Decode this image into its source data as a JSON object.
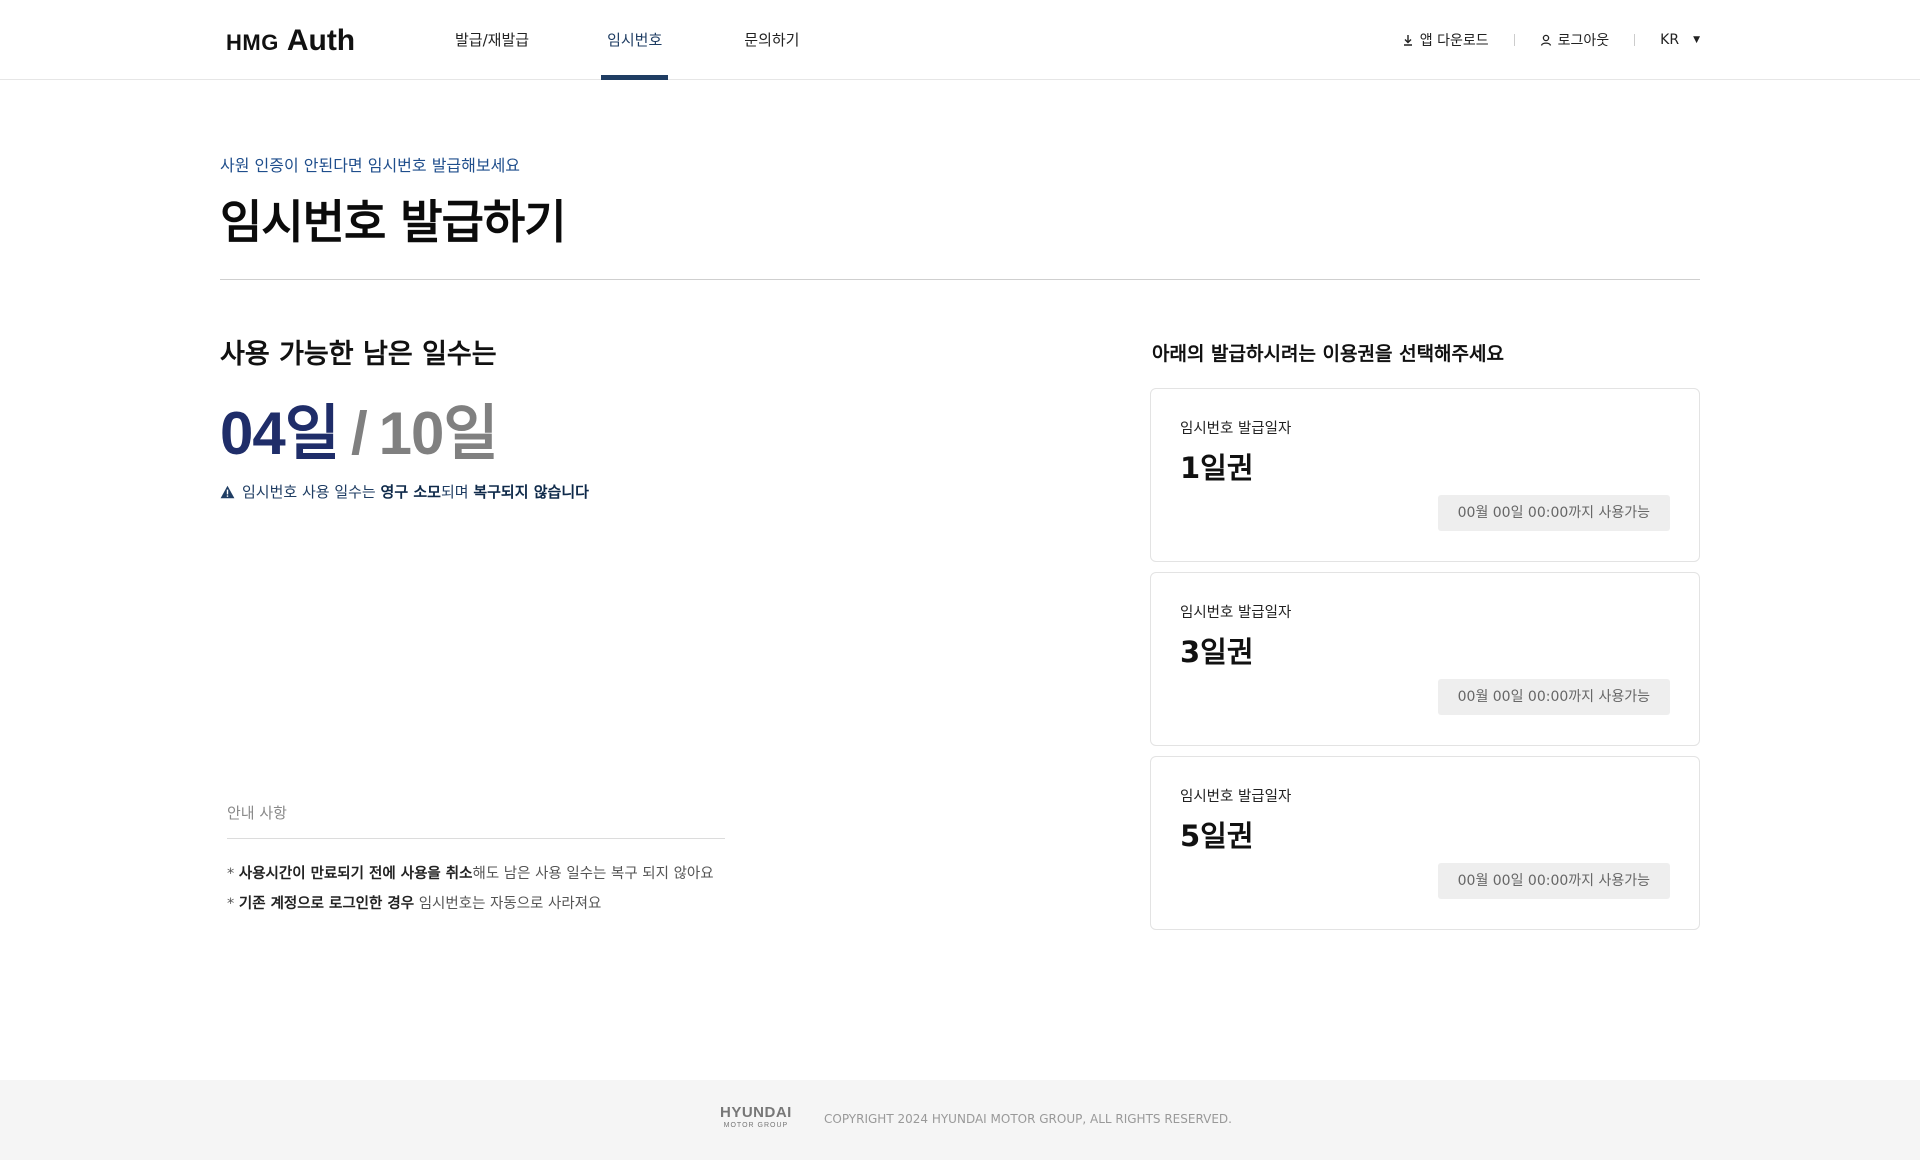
{
  "header": {
    "logo_prefix": "HMG",
    "logo_main": "Auth",
    "nav": [
      "발급/재발급",
      "임시번호",
      "문의하기"
    ],
    "active_nav": "임시번호",
    "util": {
      "download": "앱 다운로드",
      "logout": "로그아웃",
      "language": "KR"
    }
  },
  "hero": {
    "subtitle": "사원 인증이 안된다면 임시번호 발급해보세요",
    "title": "임시번호 발급하기"
  },
  "remaining": {
    "label": "사용 가능한 남은 일수는",
    "used": "04일",
    "separator": "/",
    "total": "10일",
    "warning": {
      "pre": "임시번호 사용 일수는 ",
      "b1": "영구 소모",
      "mid": "되며 ",
      "b2": "복구되지 않습니다"
    }
  },
  "notice": {
    "title": "안내 사항",
    "items": [
      {
        "prefix": "* ",
        "bold": "사용시간이 만료되기 전에 사용을 취소",
        "rest": "해도 남은 사용 일수는 복구 되지 않아요"
      },
      {
        "prefix": "* ",
        "bold": "기존 계정으로 로그인한 경우",
        "rest": " 임시번호는 자동으로 사라져요"
      }
    ]
  },
  "select_prompt": "아래의 발급하시려는 이용권을 선택해주세요",
  "tickets": [
    {
      "label": "임시번호 발급일자",
      "name": "1일권",
      "availability": "00월 00일 00:00까지 사용가능"
    },
    {
      "label": "임시번호 발급일자",
      "name": "3일권",
      "availability": "00월 00일 00:00까지 사용가능"
    },
    {
      "label": "임시번호 발급일자",
      "name": "5일권",
      "availability": "00월 00일 00:00까지 사용가능"
    }
  ],
  "footer": {
    "brand": "HYUNDAI",
    "brand_sub": "MOTOR GROUP",
    "copyright": "COPYRIGHT 2024 HYUNDAI MOTOR GROUP, ALL RIGHTS RESERVED."
  },
  "colors": {
    "accent": "#1f3d63",
    "count_used": "#1f2d69",
    "count_total": "#808080",
    "badge_bg": "#eeeeee"
  }
}
